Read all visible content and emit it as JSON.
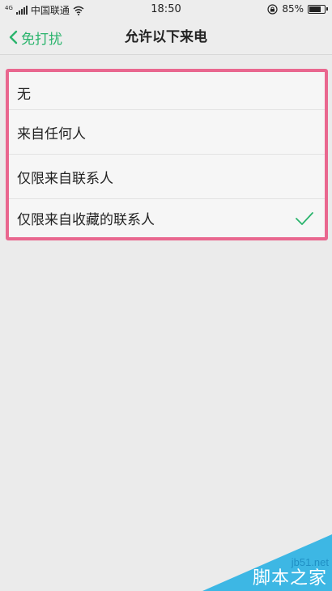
{
  "status_bar": {
    "network": "4G",
    "carrier": "中国联通",
    "time": "18:50",
    "battery_percent": "85%",
    "battery_level": 0.85
  },
  "nav": {
    "back_label": "免打扰",
    "title": "允许以下来电"
  },
  "options": [
    {
      "label": "无",
      "selected": false
    },
    {
      "label": "来自任何人",
      "selected": false
    },
    {
      "label": "仅限来自联系人",
      "selected": false
    },
    {
      "label": "仅限来自收藏的联系人",
      "selected": true
    }
  ],
  "colors": {
    "accent": "#2bb46d",
    "highlight_border": "#e9678f",
    "background": "#ebebeb"
  },
  "icons": [
    "signal-icon",
    "wifi-icon",
    "rotation-lock-icon",
    "battery-icon",
    "chevron-left-icon",
    "check-icon"
  ],
  "watermark": {
    "domain": "jb51.net",
    "name": "脚本之家"
  }
}
